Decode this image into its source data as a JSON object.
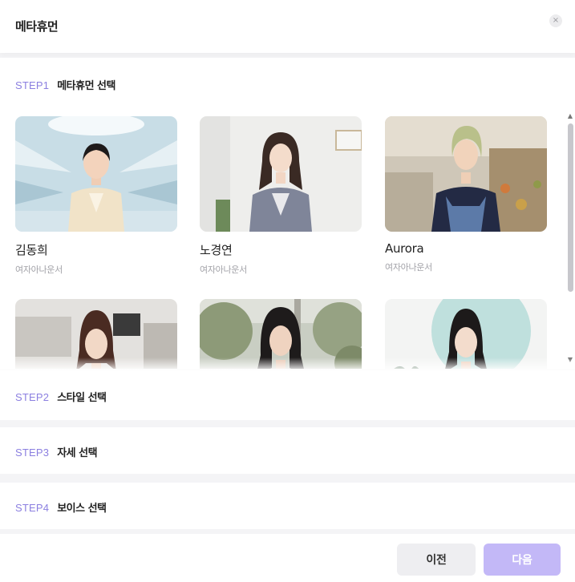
{
  "header": {
    "title": "메타휴먼",
    "close_label": "×"
  },
  "steps": [
    {
      "num": "STEP1",
      "title": "메타휴먼 선택"
    },
    {
      "num": "STEP2",
      "title": "스타일 선택"
    },
    {
      "num": "STEP3",
      "title": "자세 선택"
    },
    {
      "num": "STEP4",
      "title": "보이스 선택"
    }
  ],
  "avatars": [
    {
      "name": "김동희",
      "category": "여자아나운서"
    },
    {
      "name": "노경연",
      "category": "여자아나운서"
    },
    {
      "name": "Aurora",
      "category": "여자아나운서"
    },
    {
      "name": "",
      "category": ""
    },
    {
      "name": "",
      "category": ""
    },
    {
      "name": "",
      "category": ""
    }
  ],
  "footer": {
    "prev_label": "이전",
    "next_label": "다음"
  },
  "colors": {
    "accent": "#8b7fe0",
    "next_button": "#c3b8f7",
    "prev_button": "#eeeef1"
  }
}
